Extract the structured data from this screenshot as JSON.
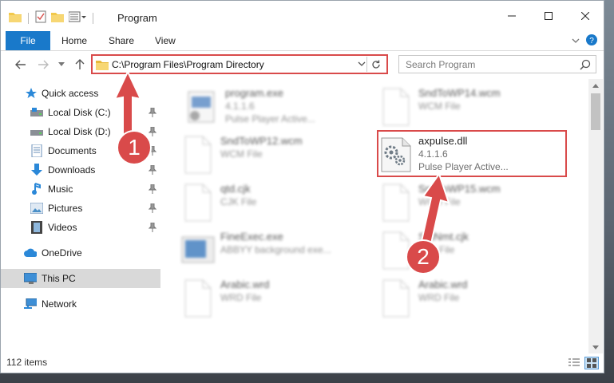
{
  "window": {
    "title": "Program",
    "controls": [
      "minimize",
      "maximize",
      "close"
    ]
  },
  "ribbon": {
    "file_tab": "File",
    "tabs": [
      "Home",
      "Share",
      "View"
    ]
  },
  "address": {
    "path": "C:\\Program Files\\Program Directory"
  },
  "search": {
    "placeholder": "Search Program"
  },
  "nav_pane": {
    "items": [
      {
        "label": "Quick access",
        "icon": "star-icon"
      },
      {
        "label": "Local Disk (C:)",
        "icon": "drive-icon"
      },
      {
        "label": "Local Disk (D:)",
        "icon": "drive-icon"
      },
      {
        "label": "Documents",
        "icon": "documents-icon"
      },
      {
        "label": "Downloads",
        "icon": "download-icon"
      },
      {
        "label": "Music",
        "icon": "music-icon"
      },
      {
        "label": "Pictures",
        "icon": "pictures-icon"
      },
      {
        "label": "Videos",
        "icon": "videos-icon"
      },
      {
        "label": "OneDrive",
        "icon": "cloud-icon"
      },
      {
        "label": "This PC",
        "icon": "computer-icon"
      },
      {
        "label": "Network",
        "icon": "network-icon"
      }
    ]
  },
  "files": [
    {
      "name": "program.exe",
      "line2": "4.1.1.6",
      "line3": "Pulse Player Active..."
    },
    {
      "name": "SndToWP14.wcm",
      "line2": "WCM File",
      "line3": ""
    },
    {
      "name": "SndToWP12.wcm",
      "line2": "WCM File",
      "line3": ""
    },
    {
      "name": "axpulse.dll",
      "line2": "4.1.1.6",
      "line3": "Pulse Player Active..."
    },
    {
      "name": "qtd.cjk",
      "line2": "CJK File",
      "line3": ""
    },
    {
      "name": "SndToWP15.wcm",
      "line2": "WCM File",
      "line3": ""
    },
    {
      "name": "FineExec.exe",
      "line2": "ABBYY background exe...",
      "line3": ""
    },
    {
      "name": "StdNmt.cjk",
      "line2": "CJK File",
      "line3": ""
    },
    {
      "name": "Arabic.wrd",
      "line2": "WRD File",
      "line3": ""
    },
    {
      "name": "Arabic.wrd",
      "line2": "WRD File",
      "line3": ""
    }
  ],
  "status": {
    "count": "112 items"
  },
  "annotations": {
    "step1": "1",
    "step2": "2",
    "color": "#d94a4a"
  }
}
